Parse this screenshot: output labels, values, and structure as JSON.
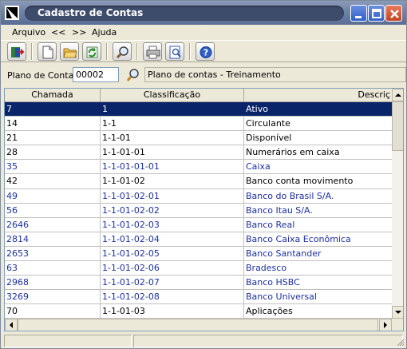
{
  "window": {
    "title": "Cadastro de Contas"
  },
  "menu": {
    "arquivo": "Arquivo",
    "prev": "<<",
    "next": ">>",
    "ajuda": "Ajuda"
  },
  "toolbar": {
    "icons": [
      "exit-icon",
      "new-doc-icon",
      "open-folder-icon",
      "refresh-icon",
      "search-icon",
      "print-icon",
      "print-preview-icon",
      "help-icon"
    ]
  },
  "plano": {
    "label": "Plano de Contas",
    "code": "00002",
    "description": "Plano de contas - Treinamento"
  },
  "grid": {
    "columns": [
      "Chamada",
      "Classificação",
      "Descriç"
    ],
    "rows": [
      {
        "chamada": "7",
        "classificacao": "1",
        "descricao": "Ativo",
        "style": "selected"
      },
      {
        "chamada": "14",
        "classificacao": "1-1",
        "descricao": "Circulante",
        "style": "normal"
      },
      {
        "chamada": "21",
        "classificacao": "1-1-01",
        "descricao": "Disponível",
        "style": "normal"
      },
      {
        "chamada": "28",
        "classificacao": "1-1-01-01",
        "descricao": "Numerários em caixa",
        "style": "normal"
      },
      {
        "chamada": "35",
        "classificacao": "1-1-01-01-01",
        "descricao": "Caixa",
        "style": "blue"
      },
      {
        "chamada": "42",
        "classificacao": "1-1-01-02",
        "descricao": "Banco conta movimento",
        "style": "normal"
      },
      {
        "chamada": "49",
        "classificacao": "1-1-01-02-01",
        "descricao": "Banco do Brasil S/A.",
        "style": "blue"
      },
      {
        "chamada": "56",
        "classificacao": "1-1-01-02-02",
        "descricao": "Banco Itau S/A.",
        "style": "blue"
      },
      {
        "chamada": "2646",
        "classificacao": "1-1-01-02-03",
        "descricao": "Banco Real",
        "style": "blue"
      },
      {
        "chamada": "2814",
        "classificacao": "1-1-01-02-04",
        "descricao": "Banco Caixa Econômica",
        "style": "blue"
      },
      {
        "chamada": "2653",
        "classificacao": "1-1-01-02-05",
        "descricao": "Banco Santander",
        "style": "blue"
      },
      {
        "chamada": "63",
        "classificacao": "1-1-01-02-06",
        "descricao": "Bradesco",
        "style": "blue"
      },
      {
        "chamada": "2968",
        "classificacao": "1-1-01-02-07",
        "descricao": "Banco HSBC",
        "style": "blue"
      },
      {
        "chamada": "3269",
        "classificacao": "1-1-01-02-08",
        "descricao": "Banco Universal",
        "style": "blue"
      },
      {
        "chamada": "70",
        "classificacao": "1-1-01-03",
        "descricao": "Aplicações",
        "style": "normal"
      }
    ]
  },
  "colors": {
    "selected_bg": "#0A246A",
    "blue_text": "#1C2FA0"
  }
}
